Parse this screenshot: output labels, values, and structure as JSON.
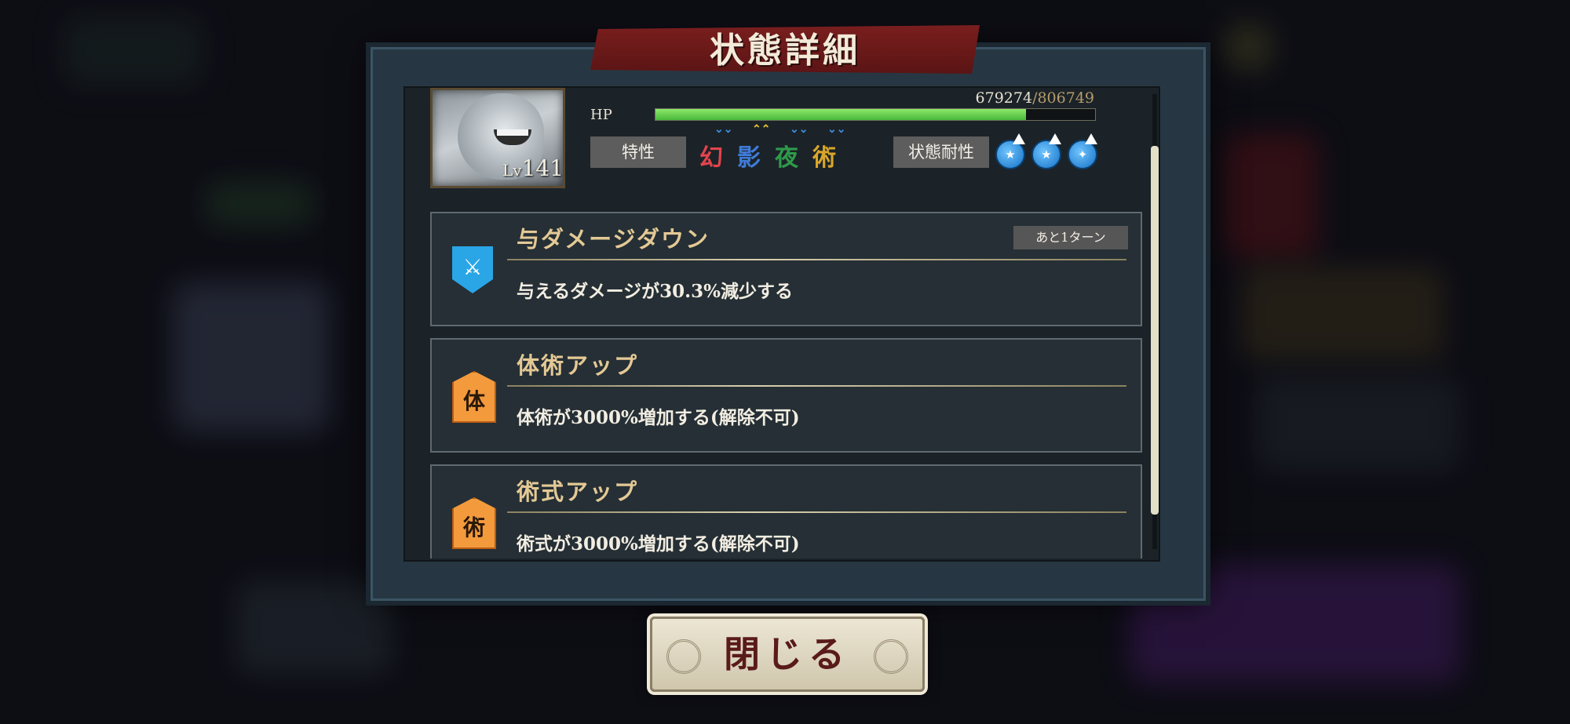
{
  "dialog": {
    "title": "状態詳細",
    "close_label": "閉じる"
  },
  "unit": {
    "level_prefix": "Lv",
    "level": "141",
    "hp_label": "HP",
    "hp_current": "679274",
    "hp_separator": "/",
    "hp_max": "806749",
    "hp_fraction": 0.842
  },
  "traits": {
    "label": "特性",
    "items": [
      {
        "glyph": "幻",
        "color": "#e2444c",
        "arrow": "⌄⌄",
        "arrow_color": "#3f8fe0"
      },
      {
        "glyph": "影",
        "color": "#3f7bd8",
        "arrow": "⌃⌃",
        "arrow_color": "#e9c531"
      },
      {
        "glyph": "夜",
        "color": "#2f9a4a",
        "arrow": "⌄⌄",
        "arrow_color": "#3f8fe0"
      },
      {
        "glyph": "術",
        "color": "#d9a62c",
        "arrow": "⌄⌄",
        "arrow_color": "#3f8fe0"
      }
    ]
  },
  "resistance": {
    "label": "状態耐性",
    "icons": [
      "resist-icon-1",
      "resist-icon-2",
      "resist-icon-3"
    ]
  },
  "effects": [
    {
      "title": "与ダメージダウン",
      "description": "与えるダメージが30.3%減少する",
      "turns": "あと1ターン",
      "icon": "sword-shield-icon",
      "icon_glyph": "⚔"
    },
    {
      "title": "体術アップ",
      "description": "体術が3000%増加する(解除不可)",
      "icon": "taijutsu-icon",
      "icon_glyph": "体"
    },
    {
      "title": "術式アップ",
      "description": "術式が3000%増加する(解除不可)",
      "icon": "jutsushiki-icon",
      "icon_glyph": "術"
    }
  ],
  "colors": {
    "accent_gold": "#e4c995",
    "hp_green": "#6dd453",
    "title_red": "#6e1a1a"
  }
}
